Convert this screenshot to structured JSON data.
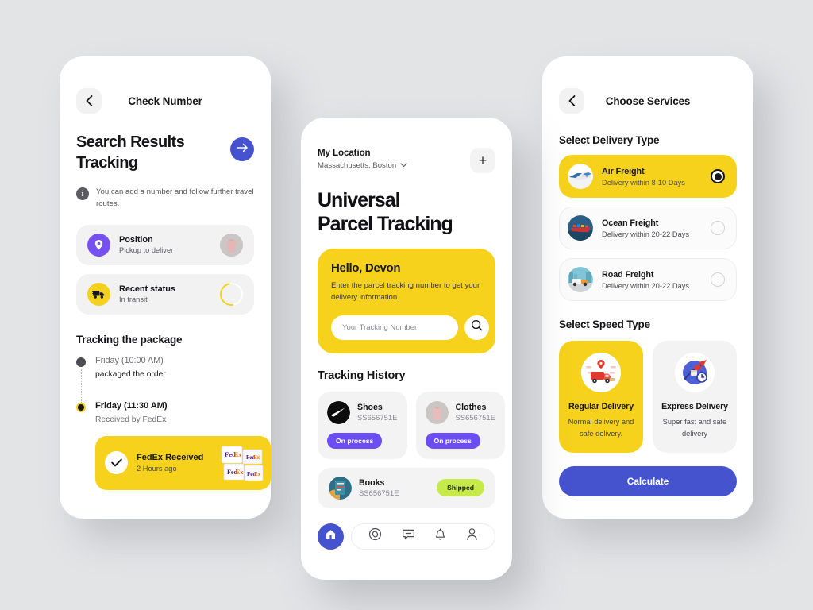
{
  "theme": {
    "background": "#e3e4e6",
    "yellow": "#f6d21d",
    "blue": "#4553cf",
    "purple": "#6b4ef2",
    "violet": "#7651f0",
    "lime": "#c6ea4a",
    "card_gray": "#f3f3f4",
    "text_dark": "#17171a",
    "text_muted": "#5d5d63"
  },
  "screen_left": {
    "topbar": {
      "title": "Check Number",
      "back_icon": "chevron-left-icon"
    },
    "hero": {
      "title_line1": "Search Results",
      "title_line2": "Tracking",
      "arrow_icon": "arrow-right-icon"
    },
    "info": {
      "icon": "info-icon",
      "glyph": "i",
      "text": "You can add a number and follow further travel routes."
    },
    "status_cards": [
      {
        "icon": "location-pin-icon",
        "title": "Position",
        "subtitle": "Pickup to deliver",
        "trailing": "clothes-thumbnail"
      },
      {
        "icon": "delivery-truck-icon",
        "title": "Recent status",
        "subtitle": "In transit",
        "trailing": "loading-spinner"
      }
    ],
    "tracking": {
      "section_title": "Tracking the package",
      "steps": [
        {
          "time": "Friday (10:00 AM)",
          "desc": "packaged the order",
          "active": false
        },
        {
          "time": "Friday (11:30 AM)",
          "desc": "Received by FedEx",
          "active": true
        }
      ],
      "highlight": {
        "icon": "check-icon",
        "title": "FedEx Received",
        "subtitle": "2 Hours ago",
        "image": "fedex-boxes-image"
      }
    }
  },
  "screen_mid": {
    "location": {
      "label": "My Location",
      "value": "Massachusetts, Boston",
      "chevron_icon": "chevron-down-icon",
      "add_icon": "plus-icon",
      "add_label": "+"
    },
    "hero_title_line1": "Universal",
    "hero_title_line2": "Parcel Tracking",
    "greeting_card": {
      "greeting": "Hello, Devon",
      "description": "Enter the parcel tracking number to get your delivery information.",
      "input_placeholder": "Your Tracking Number",
      "input_value": "",
      "search_icon": "search-icon"
    },
    "history": {
      "section_title": "Tracking History",
      "items": [
        {
          "name": "Shoes",
          "code": "SS656751E",
          "badge": "On process",
          "badge_type": "process",
          "thumb": "nike-logo-thumbnail",
          "layout": "card"
        },
        {
          "name": "Clothes",
          "code": "SS656751E",
          "badge": "On process",
          "badge_type": "process",
          "thumb": "clothes-thumbnail",
          "layout": "card"
        },
        {
          "name": "Books",
          "code": "SS656751E",
          "badge": "Shipped",
          "badge_type": "shipped",
          "thumb": "books-thumbnail",
          "layout": "wide"
        }
      ]
    },
    "tabbar": {
      "items": [
        {
          "icon": "home-icon",
          "active": true
        },
        {
          "icon": "compass-icon",
          "active": false
        },
        {
          "icon": "chat-bubble-icon",
          "active": false
        },
        {
          "icon": "bell-icon",
          "active": false
        },
        {
          "icon": "user-icon",
          "active": false
        }
      ]
    }
  },
  "screen_right": {
    "topbar": {
      "title": "Choose Services",
      "back_icon": "chevron-left-icon"
    },
    "delivery_type": {
      "section_title": "Select Delivery Type",
      "options": [
        {
          "title": "Air Freight",
          "subtitle": "Delivery within 8-10 Days",
          "thumb": "airplane-thumbnail",
          "selected": true
        },
        {
          "title": "Ocean Freight",
          "subtitle": "Delivery within 20-22 Days",
          "thumb": "cargo-ship-thumbnail",
          "selected": false
        },
        {
          "title": "Road Freight",
          "subtitle": "Delivery within 20-22 Days",
          "thumb": "truck-thumbnail",
          "selected": false
        }
      ]
    },
    "speed_type": {
      "section_title": "Select Speed Type",
      "options": [
        {
          "title": "Regular Delivery",
          "desc": "Normal delivery and safe delivery.",
          "icon": "red-delivery-van-icon",
          "selected": true
        },
        {
          "title": "Express Delivery",
          "desc": "Super fast and safe delivery",
          "icon": "express-courier-icon",
          "selected": false
        }
      ]
    },
    "calculate_label": "Calculate"
  }
}
